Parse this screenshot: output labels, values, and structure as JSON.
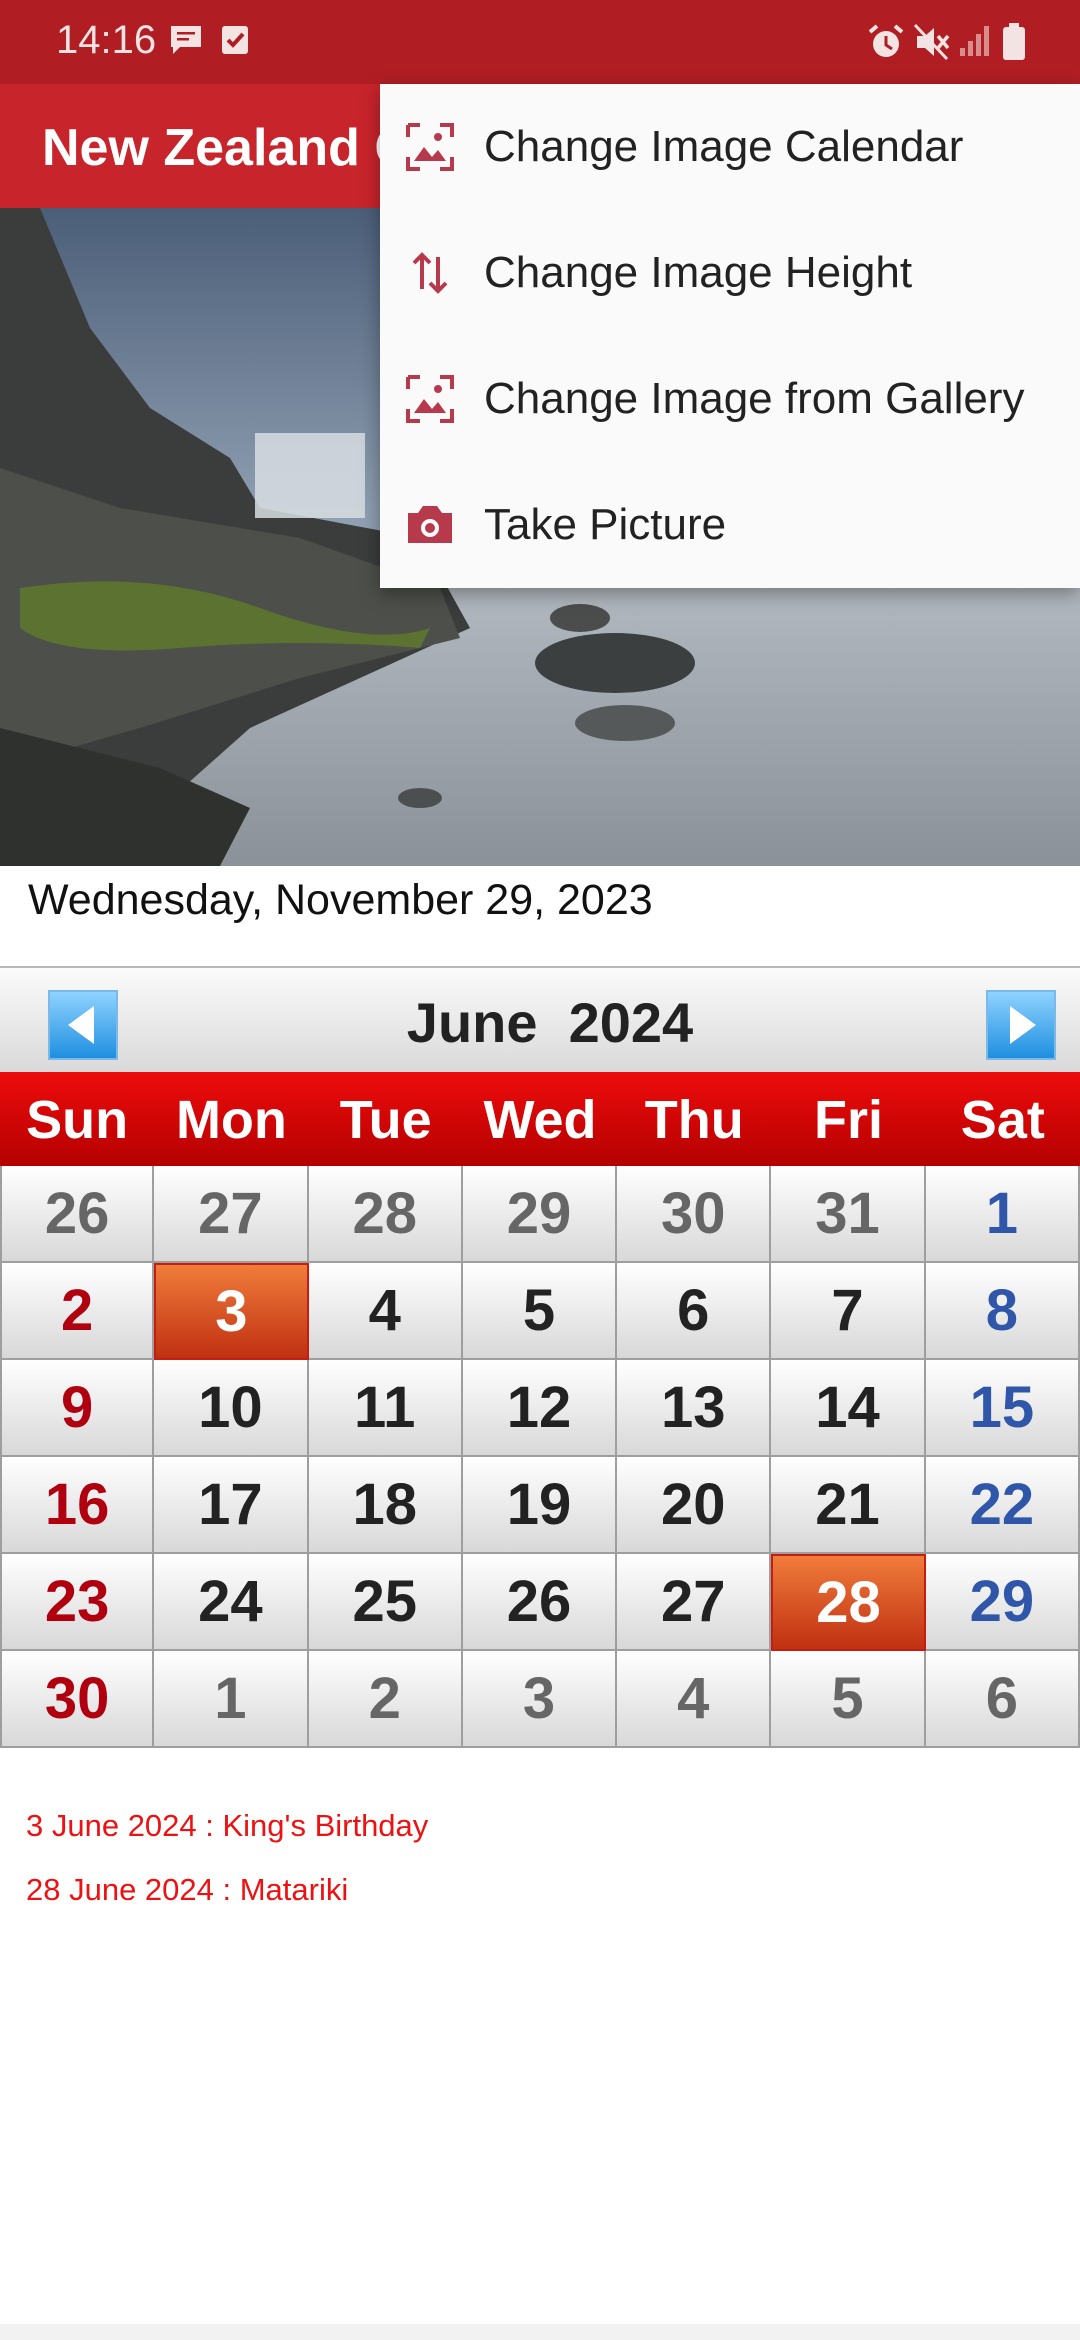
{
  "status_bar": {
    "time": "14:16",
    "left_icons": [
      "message-icon",
      "checkbox-notification-icon"
    ],
    "right_icons": [
      "alarm-icon",
      "mute-icon",
      "signal-icon",
      "battery-icon"
    ]
  },
  "app_bar": {
    "title": "New Zealand Calendar"
  },
  "hero": {
    "image": "waterfall-rocks-mist-photo"
  },
  "selected_date": "Wednesday, November 29, 2023",
  "calendar": {
    "month_label": "June  2024",
    "weekdays": [
      "Sun",
      "Mon",
      "Tue",
      "Wed",
      "Thu",
      "Fri",
      "Sat"
    ],
    "weeks": [
      [
        {
          "day": "26",
          "type": "dim"
        },
        {
          "day": "27",
          "type": "dim"
        },
        {
          "day": "28",
          "type": "dim"
        },
        {
          "day": "29",
          "type": "dim"
        },
        {
          "day": "30",
          "type": "dim"
        },
        {
          "day": "31",
          "type": "dim"
        },
        {
          "day": "1",
          "type": "sat"
        }
      ],
      [
        {
          "day": "2",
          "type": "sun"
        },
        {
          "day": "3",
          "type": "holiday"
        },
        {
          "day": "4",
          "type": "normal"
        },
        {
          "day": "5",
          "type": "normal"
        },
        {
          "day": "6",
          "type": "normal"
        },
        {
          "day": "7",
          "type": "normal"
        },
        {
          "day": "8",
          "type": "sat"
        }
      ],
      [
        {
          "day": "9",
          "type": "sun"
        },
        {
          "day": "10",
          "type": "normal"
        },
        {
          "day": "11",
          "type": "normal"
        },
        {
          "day": "12",
          "type": "normal"
        },
        {
          "day": "13",
          "type": "normal"
        },
        {
          "day": "14",
          "type": "normal"
        },
        {
          "day": "15",
          "type": "sat"
        }
      ],
      [
        {
          "day": "16",
          "type": "sun"
        },
        {
          "day": "17",
          "type": "normal"
        },
        {
          "day": "18",
          "type": "normal"
        },
        {
          "day": "19",
          "type": "normal"
        },
        {
          "day": "20",
          "type": "normal"
        },
        {
          "day": "21",
          "type": "normal"
        },
        {
          "day": "22",
          "type": "sat"
        }
      ],
      [
        {
          "day": "23",
          "type": "sun"
        },
        {
          "day": "24",
          "type": "normal"
        },
        {
          "day": "25",
          "type": "normal"
        },
        {
          "day": "26",
          "type": "normal"
        },
        {
          "day": "27",
          "type": "normal"
        },
        {
          "day": "28",
          "type": "holiday"
        },
        {
          "day": "29",
          "type": "sat"
        }
      ],
      [
        {
          "day": "30",
          "type": "sun"
        },
        {
          "day": "1",
          "type": "dim"
        },
        {
          "day": "2",
          "type": "dim"
        },
        {
          "day": "3",
          "type": "dim"
        },
        {
          "day": "4",
          "type": "dim"
        },
        {
          "day": "5",
          "type": "dim"
        },
        {
          "day": "6",
          "type": "dim"
        }
      ]
    ]
  },
  "events": [
    "3 June 2024 : King's Birthday",
    "28 June 2024 : Matariki"
  ],
  "menu": {
    "items": [
      {
        "label": "Change Image Calendar",
        "icon": "image-icon"
      },
      {
        "label": "Change Image Height",
        "icon": "swap-vertical-icon"
      },
      {
        "label": "Change Image from Gallery",
        "icon": "gallery-image-icon"
      },
      {
        "label": "Take Picture",
        "icon": "camera-icon"
      }
    ]
  },
  "colors": {
    "status_bar": "#b01e23",
    "app_bar": "#c8242b",
    "weekday_header": "#d40000",
    "holiday": "#e0521e",
    "sunday_text": "#b00010",
    "saturday_text": "#2f56a8",
    "event_text": "#e11111"
  }
}
